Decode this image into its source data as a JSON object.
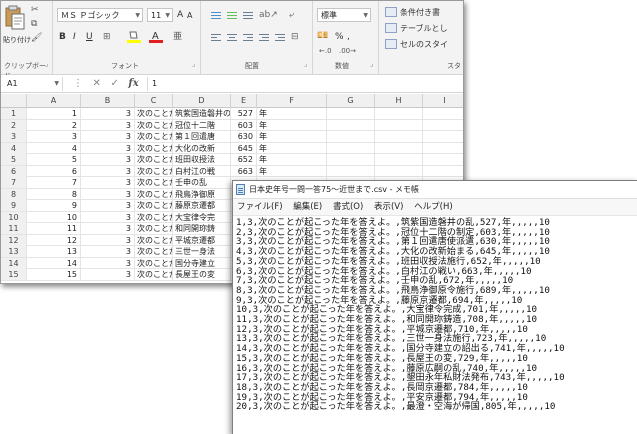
{
  "excel": {
    "clipboard": {
      "paste_label": "貼り付け",
      "group_label": "クリップボード"
    },
    "font": {
      "name": "ＭＳ Ｐゴシック",
      "size": "11",
      "grow": "A",
      "shrink": "A",
      "group_label": "フォント",
      "bold": "B",
      "italic": "I",
      "underline": "U"
    },
    "alignment": {
      "group_label": "配置"
    },
    "number": {
      "format": "標準",
      "currency": "%",
      "comma": ",",
      "group_label": "数値"
    },
    "styles": {
      "conditional": "条件付き書",
      "table": "テーブルとし",
      "cell": "セルのスタイ",
      "group_label": "スタ"
    },
    "name_box": "A1",
    "formula": "1",
    "columns": [
      "A",
      "B",
      "C",
      "D",
      "E",
      "F",
      "G",
      "H",
      "I"
    ],
    "rows": [
      {
        "n": "1",
        "a": "1",
        "b": "3",
        "c": "次のことが",
        "d": "筑紫国造磐井の乱",
        "e": "527",
        "f": "年"
      },
      {
        "n": "2",
        "a": "2",
        "b": "3",
        "c": "次のことが",
        "d": "冠位十二階",
        "e": "603",
        "f": "年"
      },
      {
        "n": "3",
        "a": "3",
        "b": "3",
        "c": "次のことが",
        "d": "第１回遣唐",
        "e": "630",
        "f": "年"
      },
      {
        "n": "4",
        "a": "4",
        "b": "3",
        "c": "次のことが",
        "d": "大化の改新",
        "e": "645",
        "f": "年"
      },
      {
        "n": "5",
        "a": "5",
        "b": "3",
        "c": "次のことが",
        "d": "班田収授法",
        "e": "652",
        "f": "年"
      },
      {
        "n": "6",
        "a": "6",
        "b": "3",
        "c": "次のことが",
        "d": "白村江の戦",
        "e": "663",
        "f": "年"
      },
      {
        "n": "7",
        "a": "7",
        "b": "3",
        "c": "次のことが",
        "d": "壬申の乱",
        "e": "",
        "f": ""
      },
      {
        "n": "8",
        "a": "8",
        "b": "3",
        "c": "次のことが",
        "d": "飛鳥浄御原",
        "e": "",
        "f": ""
      },
      {
        "n": "9",
        "a": "9",
        "b": "3",
        "c": "次のことが",
        "d": "藤原京遷都",
        "e": "",
        "f": ""
      },
      {
        "n": "10",
        "a": "10",
        "b": "3",
        "c": "次のことが",
        "d": "大宝律令完",
        "e": "",
        "f": ""
      },
      {
        "n": "11",
        "a": "11",
        "b": "3",
        "c": "次のことが",
        "d": "和同開珎鋳",
        "e": "",
        "f": ""
      },
      {
        "n": "12",
        "a": "12",
        "b": "3",
        "c": "次のことが",
        "d": "平城京遷都",
        "e": "",
        "f": ""
      },
      {
        "n": "13",
        "a": "13",
        "b": "3",
        "c": "次のことが",
        "d": "三世一身法",
        "e": "",
        "f": ""
      },
      {
        "n": "14",
        "a": "14",
        "b": "3",
        "c": "次のことが",
        "d": "国分寺建立",
        "e": "",
        "f": ""
      },
      {
        "n": "15",
        "a": "15",
        "b": "3",
        "c": "次のことが",
        "d": "長屋王の変",
        "e": "",
        "f": ""
      }
    ]
  },
  "notepad": {
    "title": "日本史年号一問一答75～近世まで.csv - メモ帳",
    "menu": [
      "ファイル(F)",
      "編集(E)",
      "書式(O)",
      "表示(V)",
      "ヘルプ(H)"
    ],
    "lines": [
      "1,3,次のことが起こった年を答えよ。,筑紫国造磐井の乱,527,年,,,,,10",
      "2,3,次のことが起こった年を答えよ。,冠位十二階の制定,603,年,,,,,10",
      "3,3,次のことが起こった年を答えよ。,第１回遣唐使派遣,630,年,,,,,10",
      "4,3,次のことが起こった年を答えよ。,大化の改新始まる,645,年,,,,,10",
      "5,3,次のことが起こった年を答えよ。,班田収授法施行,652,年,,,,,10",
      "6,3,次のことが起こった年を答えよ。,白村江の戦い,663,年,,,,,10",
      "7,3,次のことが起こった年を答えよ。,壬申の乱,672,年,,,,,10",
      "8,3,次のことが起こった年を答えよ。,飛鳥浄御原令施行,689,年,,,,,10",
      "9,3,次のことが起こった年を答えよ。,藤原京遷都,694,年,,,,,10",
      "10,3,次のことが起こった年を答えよ。,大宝律令完成,701,年,,,,,10",
      "11,3,次のことが起こった年を答えよ。,和同開珎鋳造,708,年,,,,,10",
      "12,3,次のことが起こった年を答えよ。,平城京遷都,710,年,,,,,10",
      "13,3,次のことが起こった年を答えよ。,三世一身法施行,723,年,,,,,10",
      "14,3,次のことが起こった年を答えよ。,国分寺建立の詔出る,741,年,,,,,10",
      "15,3,次のことが起こった年を答えよ。,長屋王の変,729,年,,,,,10",
      "16,3,次のことが起こった年を答えよ。,藤原広嗣の乱,740,年,,,,,10",
      "17,3,次のことが起こった年を答えよ。,墾田永年私財法発布,743,年,,,,,10",
      "18,3,次のことが起こった年を答えよ。,長岡京遷都,784,年,,,,,10",
      "19,3,次のことが起こった年を答えよ。,平安京遷都,794,年,,,,,10",
      "20,3,次のことが起こった年を答えよ。,最澄・空海が帰国,805,年,,,,,10"
    ]
  }
}
